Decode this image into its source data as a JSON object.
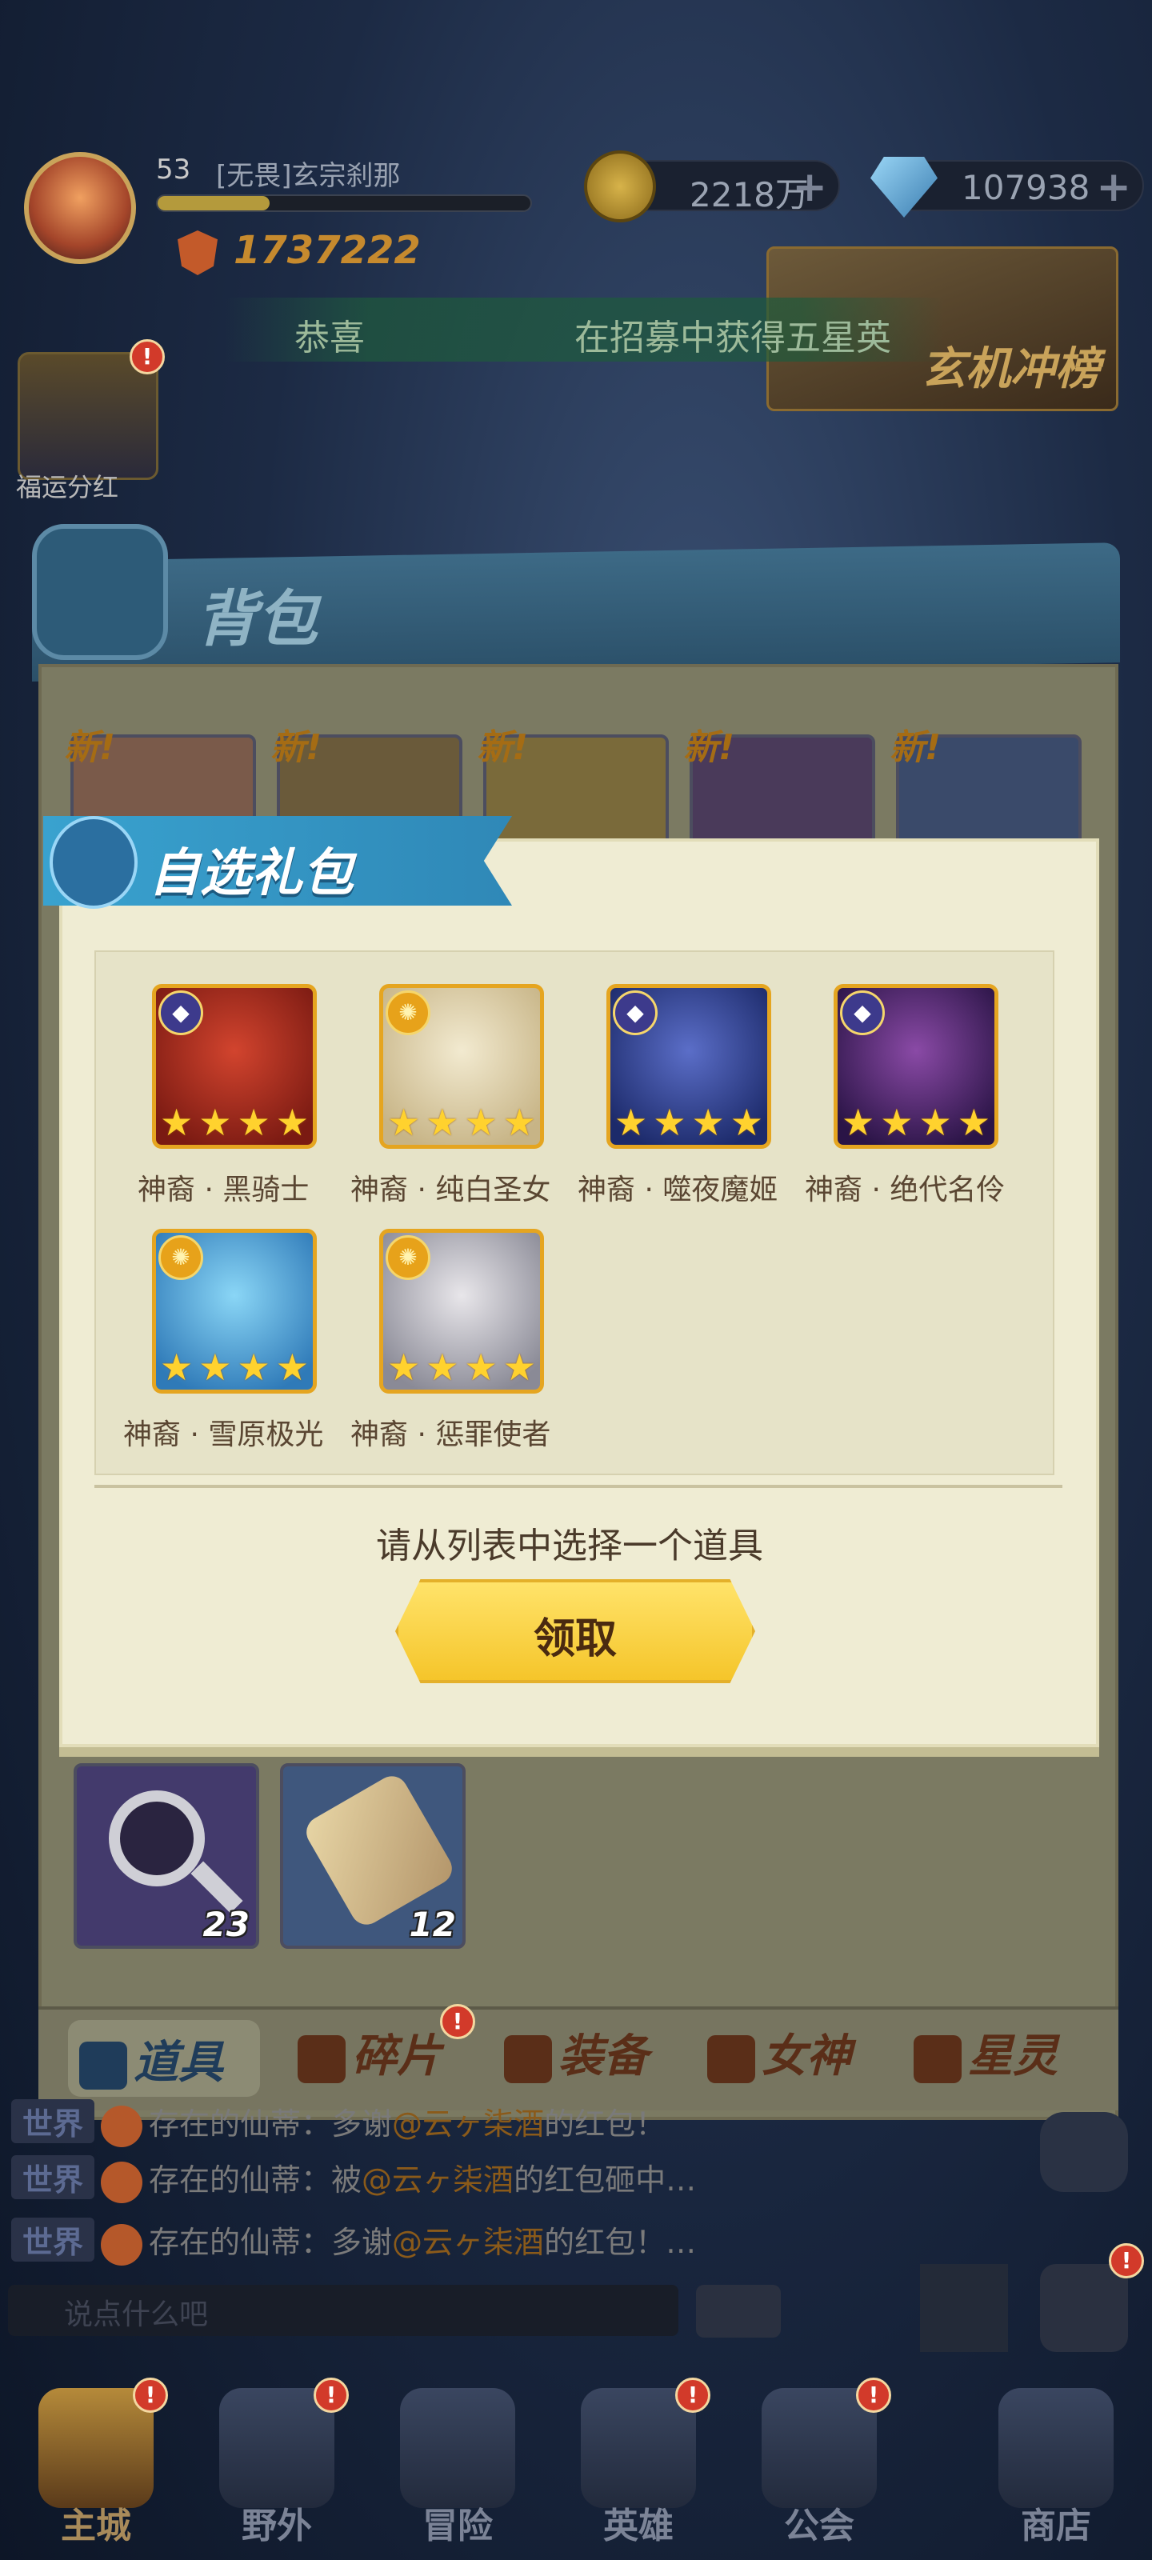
{
  "player": {
    "level": "53",
    "name": "[无畏]玄宗刹那",
    "power": "1737222",
    "xp_fraction": 0.3
  },
  "currency": {
    "gold": "2218万",
    "gems": "107938",
    "plus": "+"
  },
  "notice": {
    "part1": "恭喜",
    "part2": "在招募中获得五星英"
  },
  "event": {
    "label": "玄机冲榜"
  },
  "fortune": {
    "label": "福运分红"
  },
  "badges": {
    "alert": "!"
  },
  "bag": {
    "title": "背包",
    "new_tag": "新!",
    "items": [
      {
        "count": "23",
        "icon": "magnifier-icon"
      },
      {
        "count": "12",
        "icon": "scroll-icon"
      }
    ],
    "tabs": [
      "道具",
      "碎片",
      "装备",
      "女神",
      "星灵"
    ]
  },
  "dialog": {
    "title": "自选礼包",
    "stars": "★",
    "heroes": [
      {
        "name": "神裔 · 黑骑士",
        "faction": "dark",
        "colors": [
          "#d2442e",
          "#7a1a12"
        ]
      },
      {
        "name": "神裔 · 纯白圣女",
        "faction": "light",
        "colors": [
          "#f2ead0",
          "#c7b486"
        ]
      },
      {
        "name": "神裔 · 噬夜魔姬",
        "faction": "dark",
        "colors": [
          "#5b6ec8",
          "#1c2a6a"
        ]
      },
      {
        "name": "神裔 · 绝代名伶",
        "faction": "dark",
        "colors": [
          "#8a4aa6",
          "#2a1446"
        ]
      },
      {
        "name": "神裔 · 雪原极光",
        "faction": "light",
        "colors": [
          "#8ad6f6",
          "#2f7ab8"
        ]
      },
      {
        "name": "神裔 · 惩罪使者",
        "faction": "light",
        "colors": [
          "#e8e6ea",
          "#8a8a96"
        ]
      }
    ],
    "prompt": "请从列表中选择一个道具",
    "claim_label": "领取"
  },
  "chat": {
    "channel": "世界",
    "lines": [
      {
        "speaker": "存在的仙蒂：",
        "pre": "多谢",
        "mention": "@云ヶ柒酒",
        "post": "的红包！"
      },
      {
        "speaker": "存在的仙蒂：",
        "pre": "被",
        "mention": "@云ヶ柒酒",
        "post": "的红包砸中…"
      },
      {
        "speaker": "存在的仙蒂：",
        "pre": "多谢",
        "mention": "@云ヶ柒酒",
        "post": "的红包！…"
      }
    ],
    "input_placeholder": "说点什么吧"
  },
  "nav": [
    "主城",
    "野外",
    "冒险",
    "英雄",
    "公会",
    "商店"
  ]
}
